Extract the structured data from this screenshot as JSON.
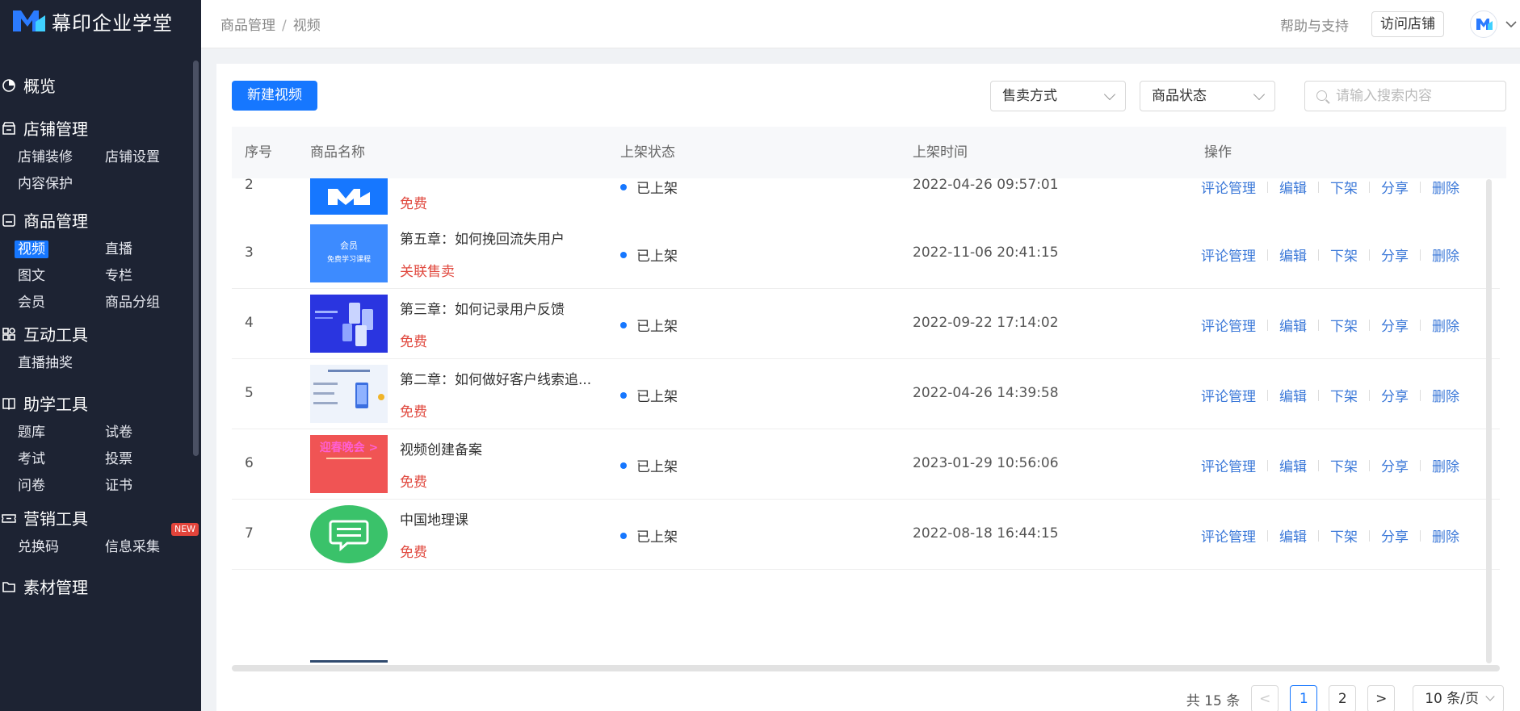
{
  "app": {
    "name": "幕印企业学堂"
  },
  "sidebar": {
    "groups": [
      {
        "title": "概览",
        "icon": "clock-pie-icon",
        "items": []
      },
      {
        "title": "店铺管理",
        "icon": "store-icon",
        "items": [
          "店铺装修",
          "店铺设置",
          "内容保护"
        ]
      },
      {
        "title": "商品管理",
        "icon": "product-icon",
        "items": [
          "视频",
          "直播",
          "图文",
          "专栏",
          "会员",
          "商品分组"
        ]
      },
      {
        "title": "互动工具",
        "icon": "grid-icon",
        "items": [
          "直播抽奖"
        ]
      },
      {
        "title": "助学工具",
        "icon": "book-icon",
        "items": [
          "题库",
          "试卷",
          "考试",
          "投票",
          "问卷",
          "证书"
        ]
      },
      {
        "title": "营销工具",
        "icon": "ticket-icon",
        "items": [
          "兑换码",
          "信息采集"
        ]
      },
      {
        "title": "素材管理",
        "icon": "folder-icon",
        "items": []
      }
    ],
    "active_item": "视频",
    "new_badge": "NEW"
  },
  "header": {
    "breadcrumb": [
      "商品管理",
      "视频"
    ],
    "breadcrumb_sep": "/",
    "help": "帮助与支持",
    "visit_store": "访问店铺"
  },
  "toolbar": {
    "new_button": "新建视频",
    "sell_mode": "售卖方式",
    "product_status": "商品状态",
    "search_placeholder": "请输入搜索内容"
  },
  "table": {
    "columns": [
      "序号",
      "商品名称",
      "上架状态",
      "上架时间",
      "操作"
    ],
    "ops": [
      "评论管理",
      "编辑",
      "下架",
      "分享",
      "删除"
    ],
    "rows": [
      {
        "idx": "2",
        "name": "",
        "type": "免费",
        "status": "已上架",
        "time": "2022-04-26 09:57:01",
        "thumb": "logo"
      },
      {
        "idx": "3",
        "name": "第五章：如何挽回流失用户",
        "type": "关联售卖",
        "status": "已上架",
        "time": "2022-11-06 20:41:15",
        "thumb": "blue-light"
      },
      {
        "idx": "4",
        "name": "第三章：如何记录用户反馈",
        "type": "免费",
        "status": "已上架",
        "time": "2022-09-22 17:14:02",
        "thumb": "blue-dark"
      },
      {
        "idx": "5",
        "name": "第二章：如何做好客户线索追...",
        "type": "免费",
        "status": "已上架",
        "time": "2022-04-26 14:39:58",
        "thumb": "doc"
      },
      {
        "idx": "6",
        "name": "视频创建备案",
        "type": "免费",
        "status": "已上架",
        "time": "2023-01-29 10:56:06",
        "thumb": "red"
      },
      {
        "idx": "7",
        "name": "中国地理课",
        "type": "免费",
        "status": "已上架",
        "time": "2022-08-18 16:44:15",
        "thumb": "green-chat"
      }
    ]
  },
  "thumbs": {
    "blue_light_line1": "会员",
    "blue_light_line2": "免费学习课程",
    "red_line1": "迎春晚会 >"
  },
  "pagination": {
    "total": "共 15 条",
    "prev": "<",
    "pages": [
      "1",
      "2"
    ],
    "current": "1",
    "next": ">",
    "page_size": "10 条/页"
  },
  "colors": {
    "primary": "#1677ff",
    "sidebar_bg": "#1d2333",
    "danger": "#e0483e"
  }
}
